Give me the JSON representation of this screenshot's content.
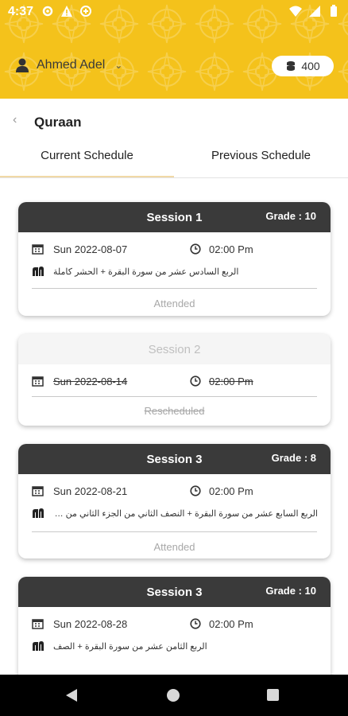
{
  "statusbar": {
    "time": "4:37"
  },
  "header": {
    "user_name": "Ahmed Adel",
    "coins": "400",
    "accent_color": "#F4C21B"
  },
  "title": "Quraan",
  "tabs": [
    {
      "label": "Current Schedule",
      "active": true
    },
    {
      "label": "Previous Schedule",
      "active": false
    }
  ],
  "sessions": [
    {
      "title": "Session 1",
      "grade": "Grade : 10",
      "date": "Sun 2022-08-07",
      "time": "02:00 Pm",
      "content": "الربع السادس عشر من سورة البقرة + الحشر كاملة",
      "status": "Attended"
    },
    {
      "title": "Session 2",
      "grade": "",
      "date": "Sun 2022-08-14",
      "time": "02:00 Pm",
      "content": "",
      "status": "Rescheduled"
    },
    {
      "title": "Session 3",
      "grade": "Grade : 8",
      "date": "Sun 2022-08-21",
      "time": "02:00 Pm",
      "content": "الربع السابع عشر من سورة البقرة + النصف الثاني من الجزء الثاني من القرآ...",
      "status": "Attended"
    },
    {
      "title": "Session 3",
      "grade": "Grade : 10",
      "date": "Sun 2022-08-28",
      "time": "02:00 Pm",
      "content": "الربع الثامن عشر من سورة البقرة + الصف",
      "status": ""
    }
  ]
}
